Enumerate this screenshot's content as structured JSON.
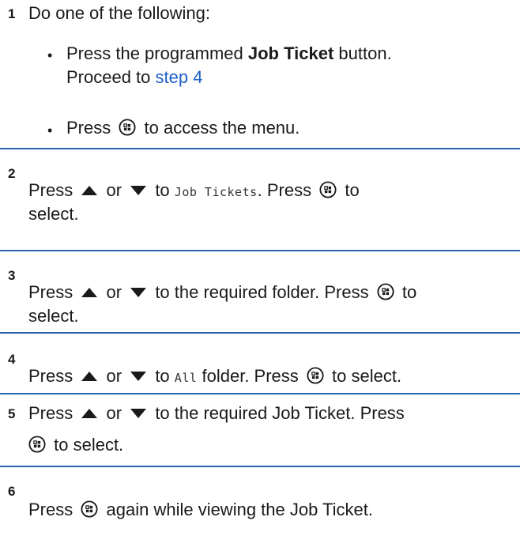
{
  "step1": {
    "number": "1",
    "intro": "Do one of the following:",
    "bullet_a_pre": "Press the programmed ",
    "bullet_a_bold": "Job Ticket",
    "bullet_a_post": " button.",
    "bullet_a_line2": "Proceed to ",
    "bullet_a_link": "step 4",
    "bullet_b_pre": "Press",
    "bullet_b_post": "to access the menu."
  },
  "step2": {
    "number": "2",
    "press": "Press",
    "or": "or",
    "to": "to",
    "menu_item": "Job Tickets",
    "press2": ". Press",
    "to2": "to",
    "line2": "select."
  },
  "step3": {
    "number": "3",
    "press": "Press",
    "or": "or",
    "text": "to the required folder. Press",
    "to2": "to",
    "line2": "select."
  },
  "step4": {
    "number": "4",
    "press": "Press",
    "or": "or",
    "to": "to",
    "menu_item": "All",
    "text": "folder. Press",
    "end": "to select."
  },
  "step5": {
    "number": "5",
    "press": "Press",
    "or": "or",
    "text": "to the required Job Ticket. Press",
    "end": "to select."
  },
  "step6": {
    "number": "6",
    "press": "Press",
    "text": "again while viewing the Job Ticket."
  },
  "colors": {
    "rule": "#2b63a8",
    "link": "#1f5fc9"
  },
  "icons": {
    "ok": "menu-ok-button-icon",
    "up": "up-arrow-icon",
    "down": "down-arrow-icon"
  }
}
